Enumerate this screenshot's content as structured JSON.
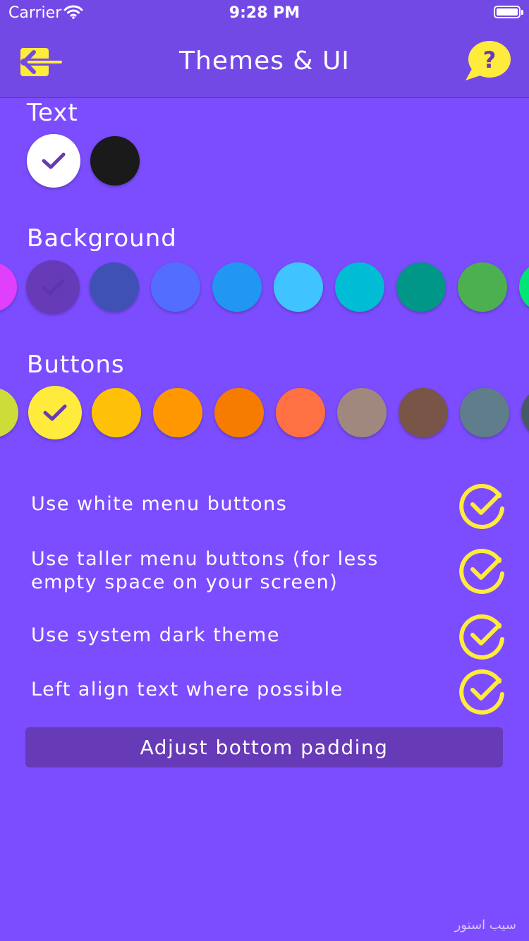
{
  "status_bar": {
    "carrier": "Carrier",
    "time": "9:28 PM"
  },
  "header": {
    "title": "Themes & UI",
    "back_icon": "back-arrow-icon",
    "help_icon": "help-bubble-icon"
  },
  "sections": {
    "text": {
      "label": "Text",
      "swatches": [
        "#ffffff",
        "#1a1a1a"
      ],
      "selected_index": 0
    },
    "background": {
      "label": "Background",
      "swatches": [
        "#e040fb",
        "#673ab7",
        "#3f51b5",
        "#536dfe",
        "#2196f3",
        "#40c4ff",
        "#00bcd4",
        "#009688",
        "#4caf50",
        "#00e676"
      ],
      "selected_index": 1
    },
    "buttons": {
      "label": "Buttons",
      "swatches": [
        "#cddc39",
        "#ffeb3b",
        "#ffc107",
        "#ff9800",
        "#f57c00",
        "#ff7043",
        "#a1887f",
        "#795548",
        "#607d8b",
        "#455a64"
      ],
      "selected_index": 1
    }
  },
  "options": [
    {
      "label": "Use white menu buttons",
      "checked": true
    },
    {
      "label": "Use taller menu buttons (for less empty space on your screen)",
      "checked": true
    },
    {
      "label": "Use system dark theme",
      "checked": true
    },
    {
      "label": "Left align text where possible",
      "checked": true
    }
  ],
  "adjust_button": {
    "label": "Adjust bottom padding"
  },
  "watermark": "سیب استور",
  "colors": {
    "accent": "#ffeb3b",
    "background": "#7c4dff",
    "header": "#7349e6",
    "button_bg": "#673ab7"
  }
}
